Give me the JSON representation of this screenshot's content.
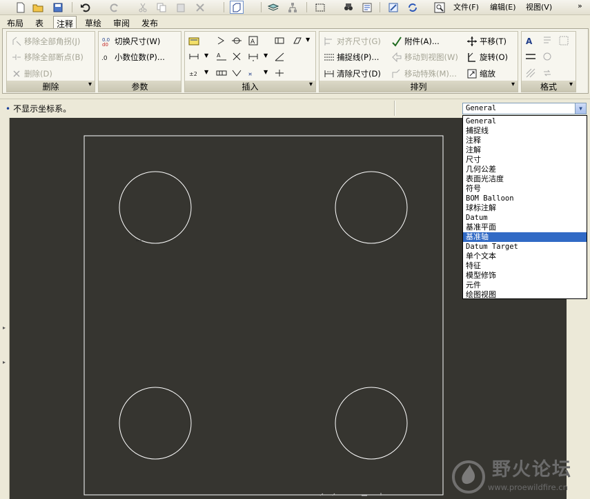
{
  "menu": {
    "file": "文件(F)",
    "edit": "编辑(E)",
    "view": "视图(V)",
    "more": "»"
  },
  "tabs": [
    {
      "label": "布局"
    },
    {
      "label": "表"
    },
    {
      "label": "注释",
      "active": true
    },
    {
      "label": "草绘"
    },
    {
      "label": "审阅"
    },
    {
      "label": "发布"
    }
  ],
  "ribbon": {
    "delete_group": {
      "title": "删除",
      "remove_all_corners": "移除全部角拐(J)",
      "remove_all_breaks": "移除全部断点(B)",
      "delete": "删除(D)"
    },
    "param_group": {
      "title": "参数",
      "toggle_dimension": "切换尺寸(W)",
      "decimal_places": "小数位数(P)..."
    },
    "insert_group": {
      "title": "插入"
    },
    "arrange_group": {
      "title": "排列",
      "align_dimension": "对齐尺寸(G)",
      "attach": "附件(A)...",
      "snap_line": "捕捉线(P)...",
      "move_to_view": "移动到视图(W)",
      "clean_dimension": "清除尺寸(D)",
      "move_special": "移动特殊(M)...",
      "translate": "平移(T)",
      "rotate": "旋转(O)",
      "scale": "缩放"
    },
    "format_group": {
      "title": "格式"
    }
  },
  "message": "不显示坐标系。",
  "filter": {
    "selected": "General",
    "options": [
      "General",
      "捕捉线",
      "注释",
      "注解",
      "尺寸",
      "几何公差",
      "表面光洁度",
      "符号",
      "BOM Balloon",
      "球标注解",
      "Datum",
      "基准平面",
      "基准轴",
      "Datum Target",
      "单个文本",
      "特征",
      "模型修饰",
      "元件",
      "绘图视图"
    ],
    "highlighted_index": 12
  },
  "watermark": {
    "name": "野火论坛",
    "url": "www.proewildfire.cn"
  },
  "colors": {
    "canvas": "#363530",
    "geometry": "#ffffff",
    "selection": "#316ac5"
  }
}
